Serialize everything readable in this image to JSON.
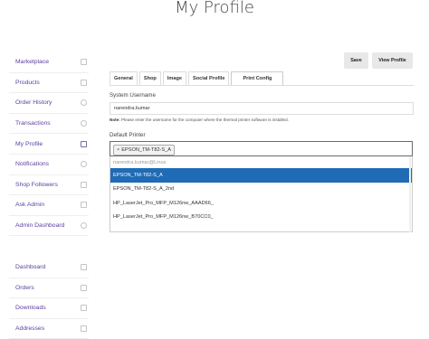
{
  "page": {
    "title": "My Profile"
  },
  "sidebar": {
    "items": [
      {
        "label": "Marketplace",
        "icon": "shop-icon"
      },
      {
        "label": "Products",
        "icon": "box-icon"
      },
      {
        "label": "Order History",
        "icon": "history-icon"
      },
      {
        "label": "Transactions",
        "icon": "dollar-icon"
      },
      {
        "label": "My Profile",
        "icon": "profile-icon"
      },
      {
        "label": "Notifications",
        "icon": "bell-icon"
      },
      {
        "label": "Shop Followers",
        "icon": "followers-icon"
      },
      {
        "label": "Ask Admin",
        "icon": "mail-icon"
      },
      {
        "label": "Admin Dashboard",
        "icon": "dashboard-icon"
      }
    ],
    "account_items": [
      {
        "label": "Dashboard",
        "icon": "dashboard-icon"
      },
      {
        "label": "Orders",
        "icon": "cart-icon"
      },
      {
        "label": "Downloads",
        "icon": "download-icon"
      },
      {
        "label": "Addresses",
        "icon": "location-icon"
      }
    ]
  },
  "actions": {
    "save": "Save",
    "view_profile": "View Profile"
  },
  "tabs": [
    "General",
    "Shop",
    "Image",
    "Social Profile",
    "Print Config"
  ],
  "active_tab": "Print Config",
  "form": {
    "username_label": "System Username",
    "username_value": "narendra.kumar",
    "note_bold": "Note:",
    "note_text": "Please enter the username for the computer where the thermal printer software is installed.",
    "printer_label": "Default Printer",
    "selected_chip": "EPSON_TM-T82-S_A",
    "chip_remove": "×",
    "options_group": "narendra.kumar@Linux",
    "options": [
      "EPSON_TM-T82-S_A",
      "EPSON_TM-T82-S_A_2nd",
      "HP_LaserJet_Pro_MFP_M126nw_AAAD66_",
      "HP_LaserJet_Pro_MFP_M126nw_B70CC0_"
    ],
    "highlighted_index": 0
  },
  "colors": {
    "accent": "#5b3fa0",
    "highlight": "#1f6bb5"
  }
}
